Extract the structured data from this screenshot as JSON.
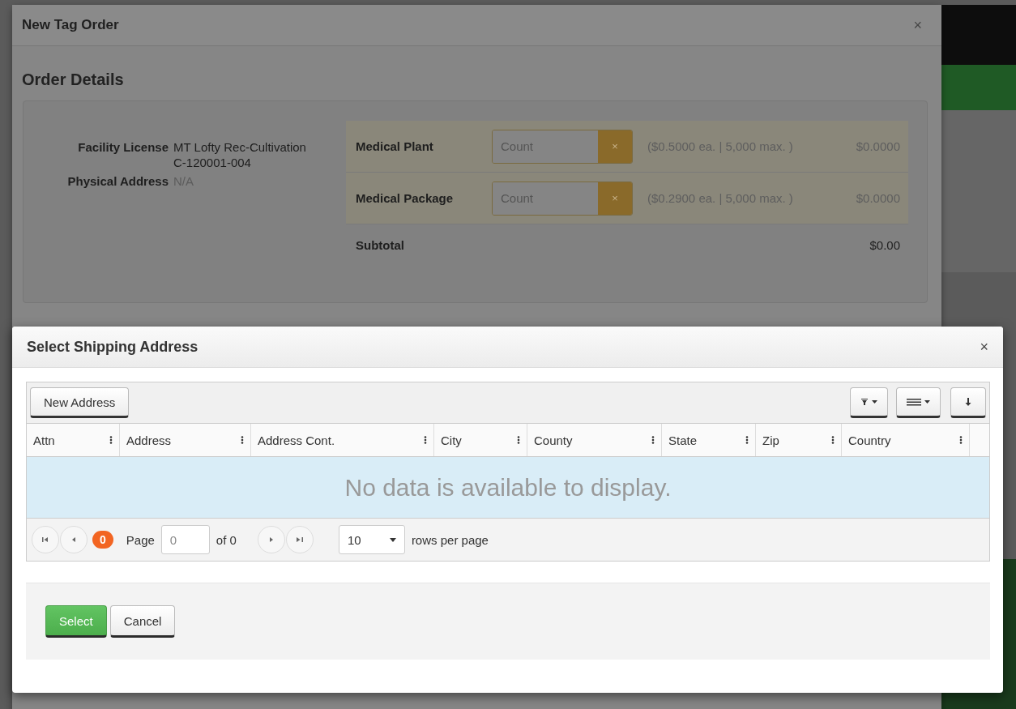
{
  "order_dialog": {
    "title": "New Tag Order",
    "close": "×",
    "heading": "Order Details",
    "facility": [
      {
        "label": "Facility License",
        "values": [
          "MT Lofty Rec-Cultivation",
          "C-120001-004"
        ],
        "muted": false
      },
      {
        "label": "Physical Address",
        "values": [
          "N/A"
        ],
        "muted": true
      }
    ],
    "items": [
      {
        "name": "Medical Plant",
        "placeholder": "Count",
        "clear": "×",
        "note": "($0.5000 ea. | 5,000 max. )",
        "total": "$0.0000"
      },
      {
        "name": "Medical Package",
        "placeholder": "Count",
        "clear": "×",
        "note": "($0.2900 ea. | 5,000 max. )",
        "total": "$0.0000"
      }
    ],
    "subtotal": {
      "label": "Subtotal",
      "value": "$0.00"
    }
  },
  "address_dialog": {
    "title": "Select Shipping Address",
    "close": "×",
    "new_button": "New Address",
    "columns": [
      "Attn",
      "Address",
      "Address Cont.",
      "City",
      "County",
      "State",
      "Zip",
      "Country"
    ],
    "empty_message": "No data is available to display.",
    "pager": {
      "count": "0",
      "page_label": "Page",
      "page_value": "0",
      "of": "of 0",
      "page_size": "10",
      "rows_label": "rows per page"
    },
    "buttons": [
      {
        "label": "Select",
        "kind": "primary"
      },
      {
        "label": "Cancel",
        "kind": "default"
      }
    ]
  }
}
